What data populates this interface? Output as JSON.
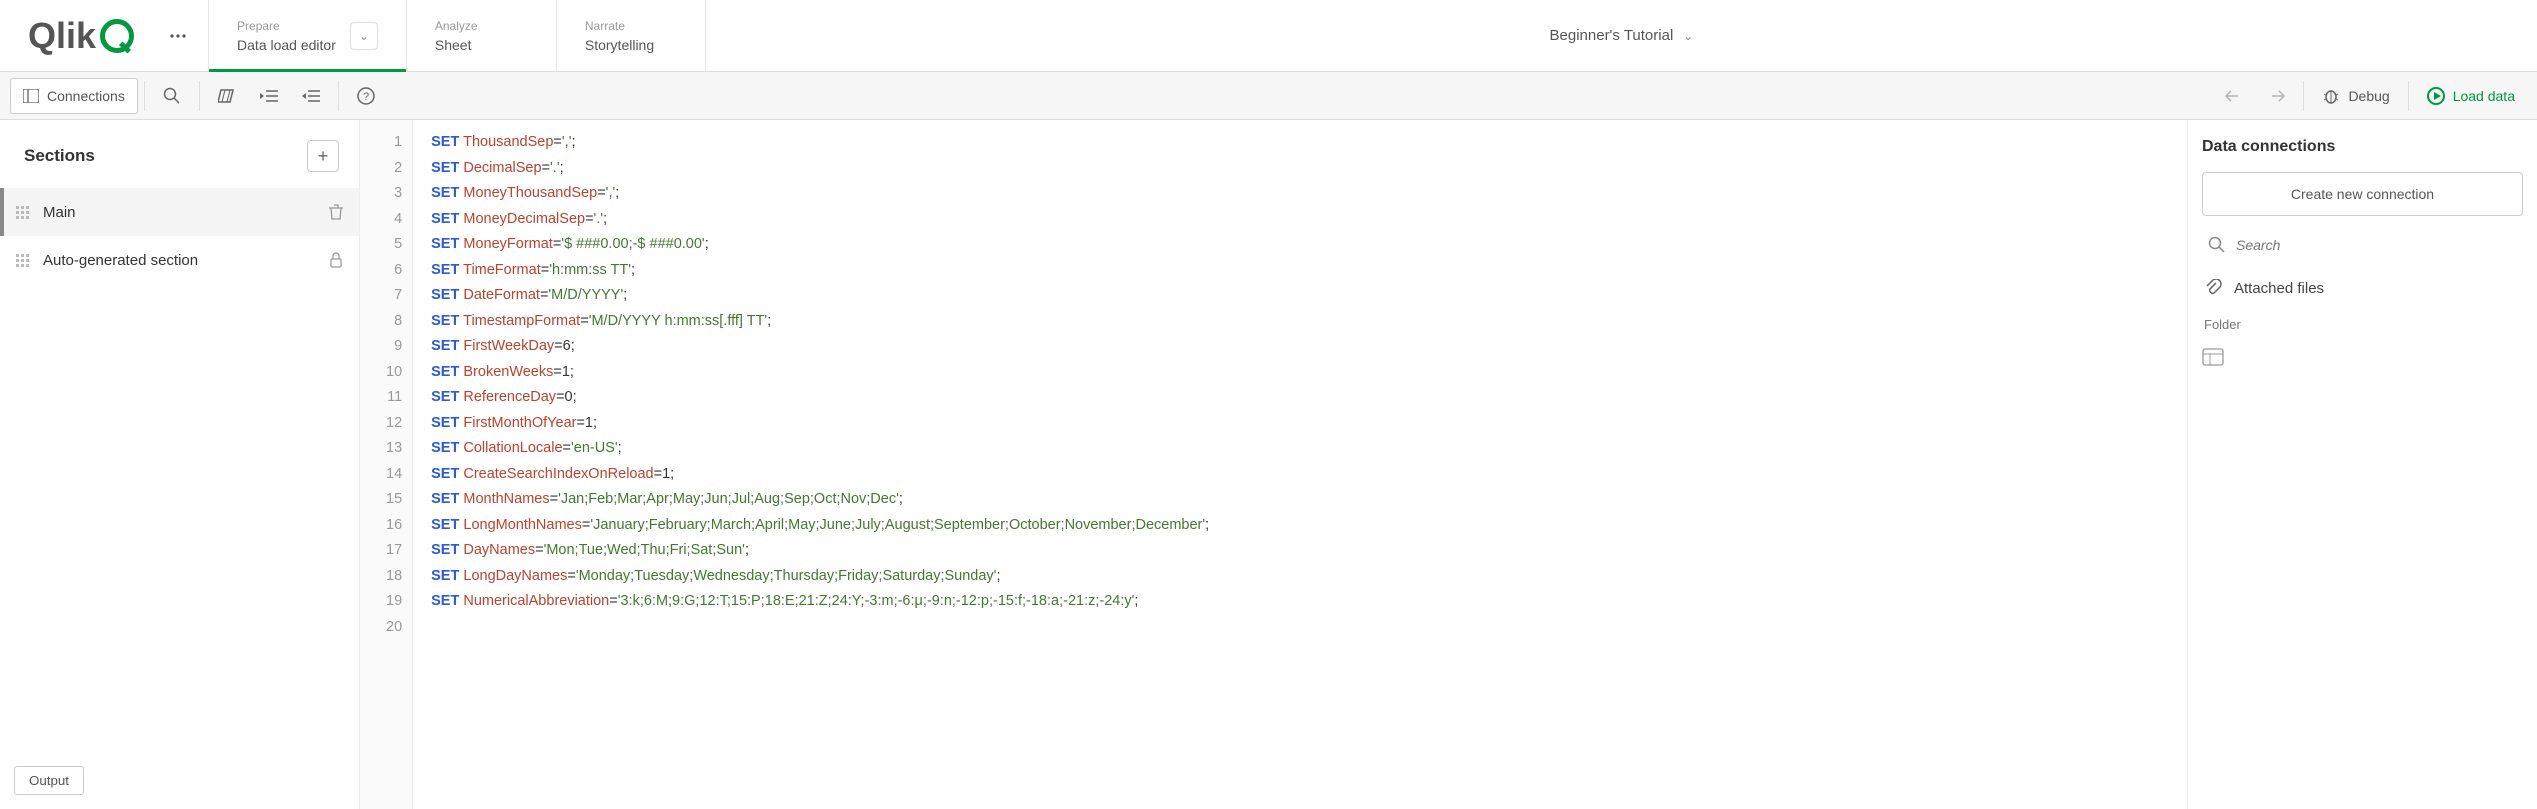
{
  "logo_text": "Qlik",
  "tabs": [
    {
      "eyebrow": "Prepare",
      "title": "Data load editor"
    },
    {
      "eyebrow": "Analyze",
      "title": "Sheet"
    },
    {
      "eyebrow": "Narrate",
      "title": "Storytelling"
    }
  ],
  "app_title": "Beginner's Tutorial",
  "toolbar": {
    "connections": "Connections",
    "debug": "Debug",
    "load": "Load data"
  },
  "sections": {
    "heading": "Sections",
    "items": [
      {
        "label": "Main"
      },
      {
        "label": "Auto-generated section"
      }
    ],
    "output": "Output"
  },
  "code_lines": [
    {
      "n": 1,
      "kw": "SET",
      "var": "ThousandSep",
      "rest": "=",
      "str": "','",
      "tail": ";"
    },
    {
      "n": 2,
      "kw": "SET",
      "var": "DecimalSep",
      "rest": "=",
      "str": "'.'",
      "tail": ";"
    },
    {
      "n": 3,
      "kw": "SET",
      "var": "MoneyThousandSep",
      "rest": "=",
      "str": "','",
      "tail": ";"
    },
    {
      "n": 4,
      "kw": "SET",
      "var": "MoneyDecimalSep",
      "rest": "=",
      "str": "'.'",
      "tail": ";"
    },
    {
      "n": 5,
      "kw": "SET",
      "var": "MoneyFormat",
      "rest": "=",
      "str": "'$ ###0.00;-$ ###0.00'",
      "tail": ";"
    },
    {
      "n": 6,
      "kw": "SET",
      "var": "TimeFormat",
      "rest": "=",
      "str": "'h:mm:ss TT'",
      "tail": ";"
    },
    {
      "n": 7,
      "kw": "SET",
      "var": "DateFormat",
      "rest": "=",
      "str": "'M/D/YYYY'",
      "tail": ";"
    },
    {
      "n": 8,
      "kw": "SET",
      "var": "TimestampFormat",
      "rest": "=",
      "str": "'M/D/YYYY h:mm:ss[.fff] TT'",
      "tail": ";"
    },
    {
      "n": 9,
      "kw": "SET",
      "var": "FirstWeekDay",
      "rest": "=6;",
      "str": "",
      "tail": ""
    },
    {
      "n": 10,
      "kw": "SET",
      "var": "BrokenWeeks",
      "rest": "=1;",
      "str": "",
      "tail": ""
    },
    {
      "n": 11,
      "kw": "SET",
      "var": "ReferenceDay",
      "rest": "=0;",
      "str": "",
      "tail": ""
    },
    {
      "n": 12,
      "kw": "SET",
      "var": "FirstMonthOfYear",
      "rest": "=1;",
      "str": "",
      "tail": ""
    },
    {
      "n": 13,
      "kw": "SET",
      "var": "CollationLocale",
      "rest": "=",
      "str": "'en-US'",
      "tail": ";"
    },
    {
      "n": 14,
      "kw": "SET",
      "var": "CreateSearchIndexOnReload",
      "rest": "=1;",
      "str": "",
      "tail": ""
    },
    {
      "n": 15,
      "kw": "SET",
      "var": "MonthNames",
      "rest": "=",
      "str": "'Jan;Feb;Mar;Apr;May;Jun;Jul;Aug;Sep;Oct;Nov;Dec'",
      "tail": ";"
    },
    {
      "n": 16,
      "kw": "SET",
      "var": "LongMonthNames",
      "rest": "=",
      "str": "'January;February;March;April;May;June;July;August;September;October;November;December'",
      "tail": ";"
    },
    {
      "n": 17,
      "kw": "SET",
      "var": "DayNames",
      "rest": "=",
      "str": "'Mon;Tue;Wed;Thu;Fri;Sat;Sun'",
      "tail": ";"
    },
    {
      "n": 18,
      "kw": "SET",
      "var": "LongDayNames",
      "rest": "=",
      "str": "'Monday;Tuesday;Wednesday;Thursday;Friday;Saturday;Sunday'",
      "tail": ";"
    },
    {
      "n": 19,
      "kw": "SET",
      "var": "NumericalAbbreviation",
      "rest": "=",
      "str": "'3:k;6:M;9:G;12:T;15:P;18:E;21:Z;24:Y;-3:m;-6:μ;-9:n;-12:p;-15:f;-18:a;-21:z;-24:y'",
      "tail": ";"
    },
    {
      "n": 20,
      "kw": "",
      "var": "",
      "rest": "",
      "str": "",
      "tail": ""
    }
  ],
  "right": {
    "heading": "Data connections",
    "new_conn": "Create new connection",
    "search_placeholder": "Search",
    "attached": "Attached files",
    "folder": "Folder"
  }
}
